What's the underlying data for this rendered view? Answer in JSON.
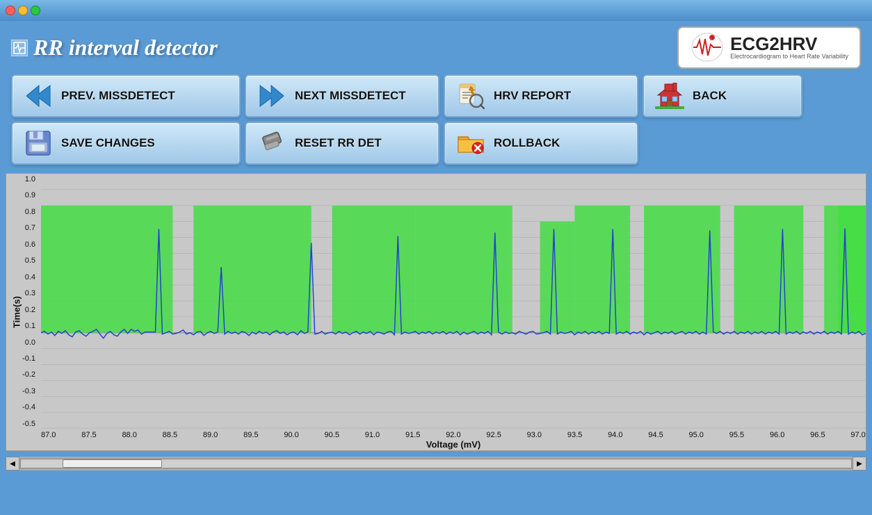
{
  "window": {
    "title": "RR interval detector"
  },
  "header": {
    "title": "RR interval detector",
    "logo_main": "ECG2HRV",
    "logo_sub": "Electrocardiogram to Heart Rate Variability"
  },
  "buttons": {
    "prev_missdetect": "PREV. MISSDETECT",
    "next_missdetect": "NEXT MISSDETECT",
    "hrv_report": "HRV REPORT",
    "back": "BACK",
    "save_changes": "SAVE CHANGES",
    "reset_rr_det": "RESET RR DET",
    "rollback": "ROLLBACK"
  },
  "chart": {
    "y_axis_label": "Time(s)",
    "x_axis_label": "Voltage (mV)",
    "y_ticks": [
      "1.0",
      "0.9",
      "0.8",
      "0.7",
      "0.6",
      "0.5",
      "0.4",
      "0.3",
      "0.2",
      "0.1",
      "0.0",
      "-0.1",
      "-0.2",
      "-0.3",
      "-0.4",
      "-0.5"
    ],
    "x_ticks": [
      "87.0",
      "87.5",
      "88.0",
      "88.5",
      "89.0",
      "89.5",
      "90.0",
      "90.5",
      "91.0",
      "91.5",
      "92.0",
      "92.5",
      "93.0",
      "93.5",
      "94.0",
      "94.5",
      "95.0",
      "95.5",
      "96.0",
      "96.5",
      "97.0"
    ]
  },
  "colors": {
    "background": "#5b9bd5",
    "button_bg": "#c8dff0",
    "chart_bg": "#c8c8c8",
    "green_bar": "#44cc44",
    "ecg_line": "#2244cc"
  }
}
